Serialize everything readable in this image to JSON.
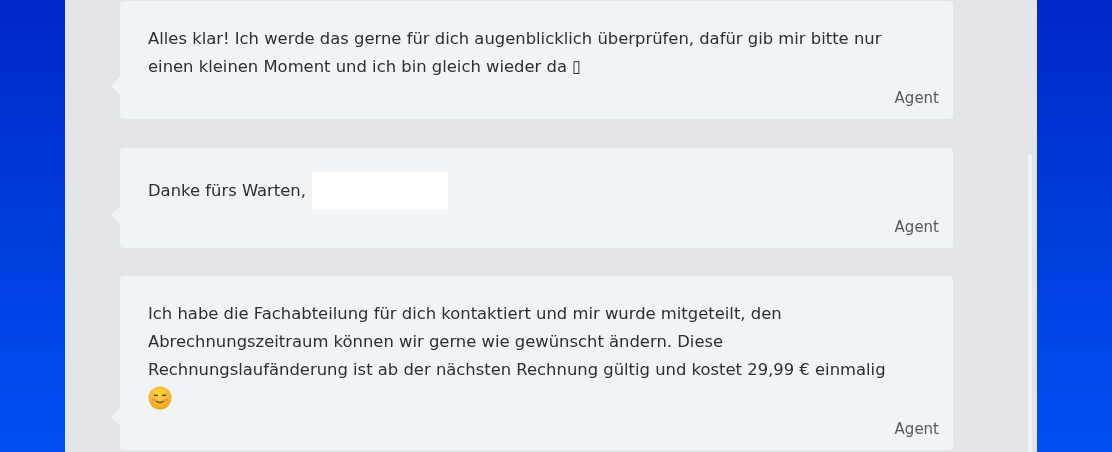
{
  "messages": [
    {
      "lines": [
        "Alles klar! Ich werde das gerne für dich augenblicklich überprüfen, dafür gib mir bitte nur",
        "einen kleinen Moment und ich bin gleich wieder da ▯"
      ],
      "sender": "Agent"
    },
    {
      "lines": [
        "Danke fürs Warten,"
      ],
      "redacted": true,
      "sender": "Agent"
    },
    {
      "lines": [
        "Ich habe die Fachabteilung für dich kontaktiert und mir wurde mitgeteilt, den",
        "Abrechnungszeitraum können wir gerne wie gewünscht ändern. Diese",
        "Rechnungslaufänderung ist ab der nächsten Rechnung gültig und kostet 29,99 € einmalig"
      ],
      "emoji": true,
      "sender": "Agent"
    }
  ]
}
